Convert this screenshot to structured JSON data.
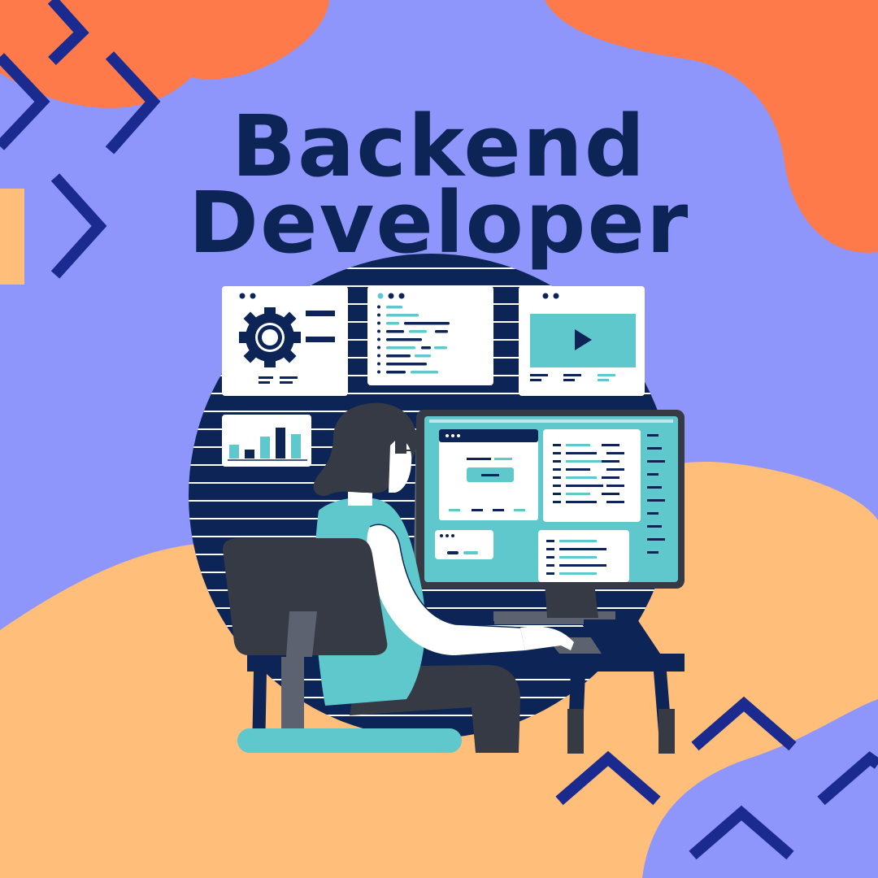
{
  "title": {
    "line1": "Backend",
    "line2": "Developer"
  },
  "colors": {
    "background": "#8f96fb",
    "blob_orange": "#ff7a4a",
    "blob_peach": "#ffbe7a",
    "navy": "#0d2456",
    "chevron": "#1b2a8e",
    "teal": "#5ec8cc",
    "dark_grey": "#363a44",
    "white": "#ffffff"
  },
  "icons": [
    "gear-icon",
    "play-icon",
    "bar-chart-icon",
    "chevron-right-icon",
    "chevron-up-icon"
  ],
  "chart_widget": {
    "bar_levels": [
      0.45,
      0.3,
      0.7,
      1.0,
      0.8
    ]
  }
}
